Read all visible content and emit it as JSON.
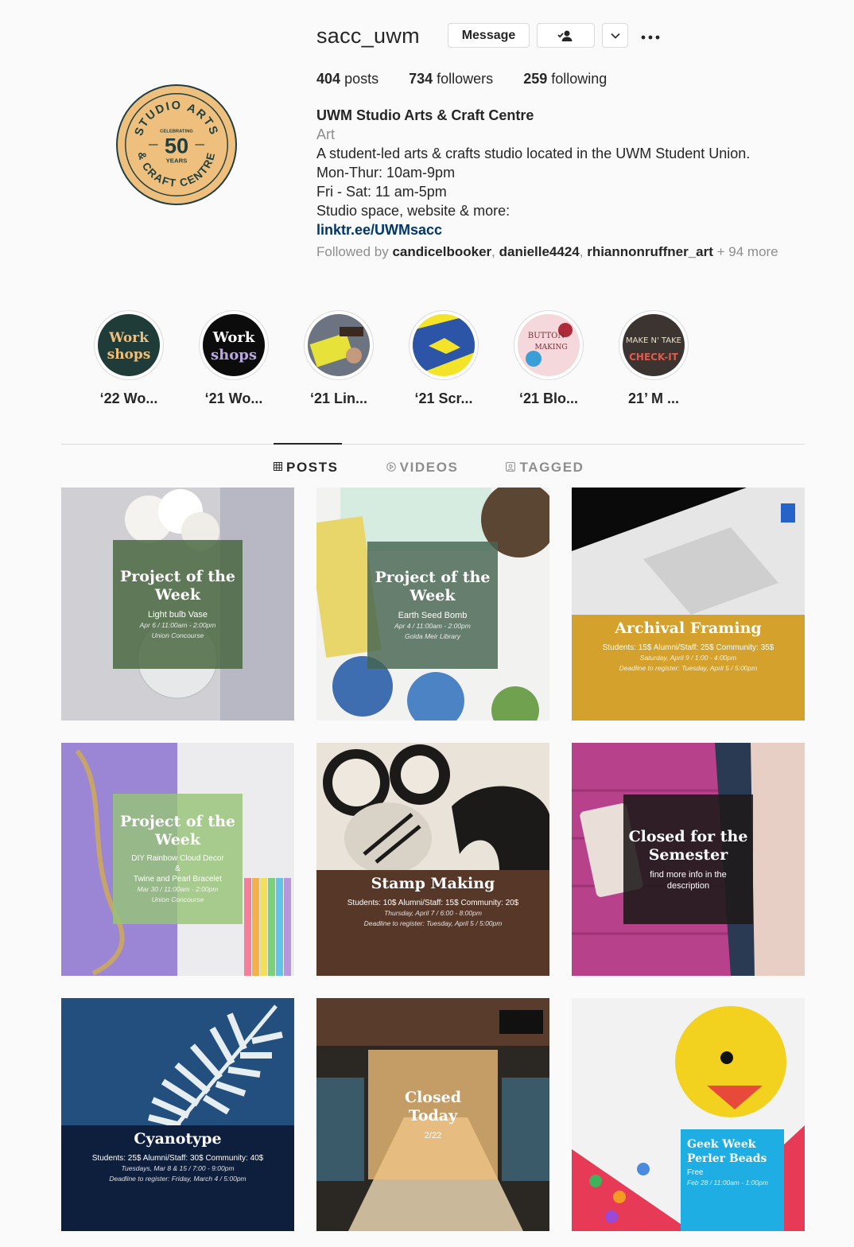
{
  "header": {
    "username": "sacc_uwm",
    "message_label": "Message",
    "follow_icon": "person-check-icon",
    "more_icon": "more-dots-icon",
    "avatar": {
      "line1": "STUDIO ARTS",
      "line2": "& CRAFT CENTRE",
      "celebrating": "CELEBRATING",
      "number": "50",
      "years": "YEARS"
    },
    "colors": {
      "avatar_bg": "#efc07d",
      "avatar_ink": "#1f3f40"
    }
  },
  "stats": {
    "posts_count": "404",
    "posts_label": "posts",
    "followers_count": "734",
    "followers_label": "followers",
    "following_count": "259",
    "following_label": "following"
  },
  "bio": {
    "name": "UWM Studio Arts & Craft Centre",
    "category": "Art",
    "lines": [
      "A student-led arts & crafts studio located in the UWM Student Union.",
      "Mon-Thur: 10am-9pm",
      "Fri - Sat: 11 am-5pm",
      "Studio space, website & more:"
    ],
    "link": "linktr.ee/UWMsacc",
    "followed_prefix": "Followed by",
    "followed_users": [
      "candicelbooker",
      "danielle4424",
      "rhiannonruffner_art"
    ],
    "followed_suffix": "+ 94 more"
  },
  "highlights": [
    {
      "label": "‘22 Wo...",
      "img_text1": "Work",
      "img_text2": "shops"
    },
    {
      "label": "‘21 Wo...",
      "img_text1": "Work",
      "img_text2": "shops"
    },
    {
      "label": "‘21 Lin..."
    },
    {
      "label": "‘21 Scr..."
    },
    {
      "label": "‘21 Blo...",
      "img_text1": "BUTTON",
      "img_text2": "MAKING"
    },
    {
      "label": "21’ M ...",
      "img_text1": "MAKE N' TAKE",
      "img_text2": "CHECK-IT"
    }
  ],
  "tabs": {
    "posts": "POSTS",
    "videos": "VIDEOS",
    "tagged": "TAGGED"
  },
  "posts": [
    {
      "title": "Project of the Week",
      "subtitle": "Light bulb Vase",
      "date": "Apr 6 / 11:00am - 2:00pm",
      "location": "Union Concourse"
    },
    {
      "title": "Project of the Week",
      "subtitle": "Earth Seed Bomb",
      "date": "Apr 4 / 11:00am - 2:00pm",
      "location": "Golda Meir Library"
    },
    {
      "title": "Archival Framing",
      "subtitle": "Students: 15$  Alumni/Staff: 25$  Community: 35$",
      "date": "Saturday, April 9 / 1:00 - 4:00pm",
      "location": "Deadline to register: Tuesday, April 5 / 5:00pm"
    },
    {
      "title": "Project of the Week",
      "subtitle": "DIY Rainbow Cloud Decor",
      "amp": "&",
      "subtitle2": "Twine and Pearl Bracelet",
      "date": "Mar 30 / 11:00am - 2:00pm",
      "location": "Union Concourse"
    },
    {
      "title": "Stamp Making",
      "subtitle": "Students: 10$  Alumni/Staff: 15$  Community: 20$",
      "date": "Thursday, April 7 / 6:00 - 8:00pm",
      "location": "Deadline to register: Tuesday, April 5 / 5:00pm"
    },
    {
      "title": "Closed for the Semester",
      "subtitle": "find more info in the description"
    },
    {
      "title": "Cyanotype",
      "subtitle": "Students: 25$  Alumni/Staff: 30$  Community: 40$",
      "date": "Tuesdays, Mar 8 & 15 / 7:00 - 9:00pm",
      "location": "Deadline to register: Friday, March 4 / 5:00pm"
    },
    {
      "title": "Closed Today",
      "subtitle": "2/22"
    },
    {
      "title": "Geek Week Perler Beads",
      "subtitle": "Free",
      "date": "Feb 28 / 11:00am - 1:00pm"
    }
  ]
}
